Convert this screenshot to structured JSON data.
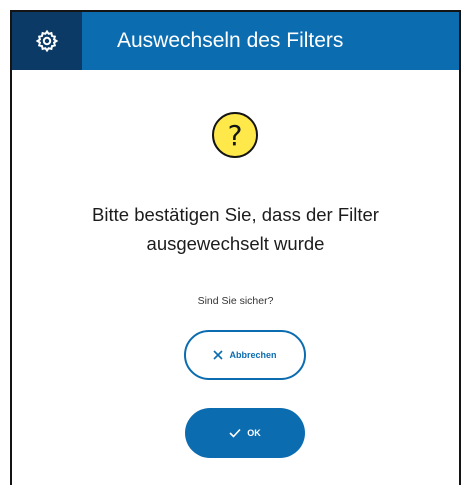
{
  "header": {
    "title": "Auswechseln des Filters",
    "icon": "gear-icon"
  },
  "dialog": {
    "status_icon": "question-icon",
    "status_glyph": "?",
    "message_line1": "Bitte bestätigen Sie, dass der Filter",
    "message_line2": "ausgewechselt wurde",
    "prompt": "Sind Sie sicher?"
  },
  "buttons": {
    "cancel_label": "Abbrechen",
    "ok_label": "OK"
  },
  "colors": {
    "header_blue": "#0c6cb0",
    "header_icon_bg": "#0b3a66",
    "question_yellow": "#ffe94a"
  }
}
